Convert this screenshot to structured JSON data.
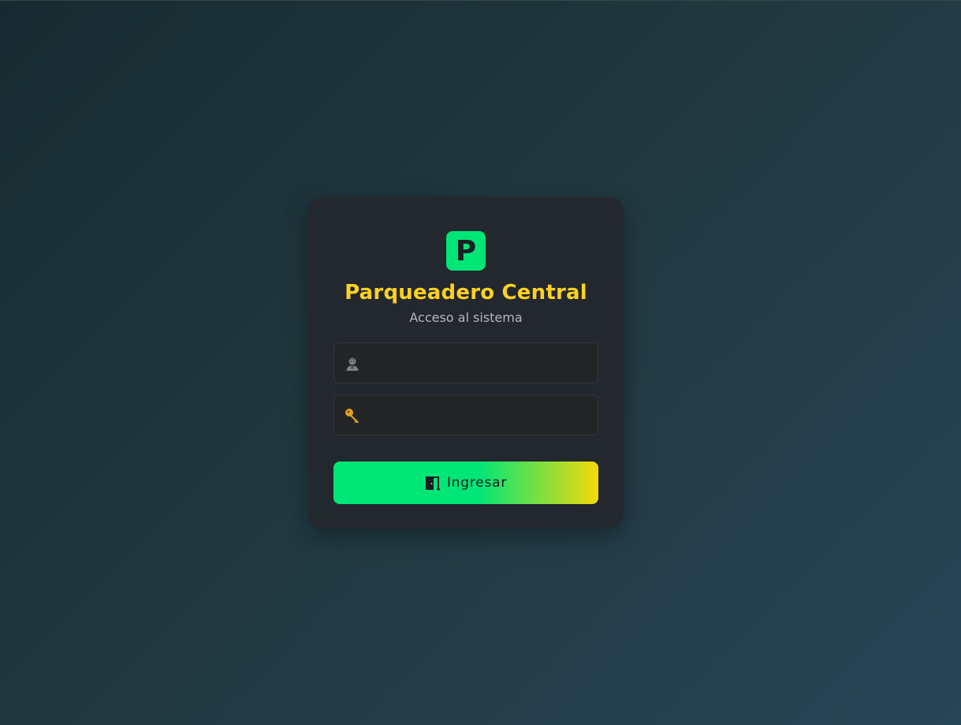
{
  "colors": {
    "accent_green": "#00e676",
    "accent_yellow": "#f5d90a",
    "title_color": "#ffd21f",
    "card_bg": "#23272e"
  },
  "logo": {
    "letter": "P",
    "icon": "parking-logo-icon"
  },
  "header": {
    "title": "Parqueadero Central",
    "subtitle": "Acceso al sistema"
  },
  "form": {
    "username": {
      "icon": "user-icon",
      "value": "",
      "placeholder": ""
    },
    "password": {
      "icon": "key-icon",
      "value": "",
      "placeholder": ""
    },
    "submit": {
      "icon": "door-icon",
      "label": "Ingresar"
    }
  }
}
